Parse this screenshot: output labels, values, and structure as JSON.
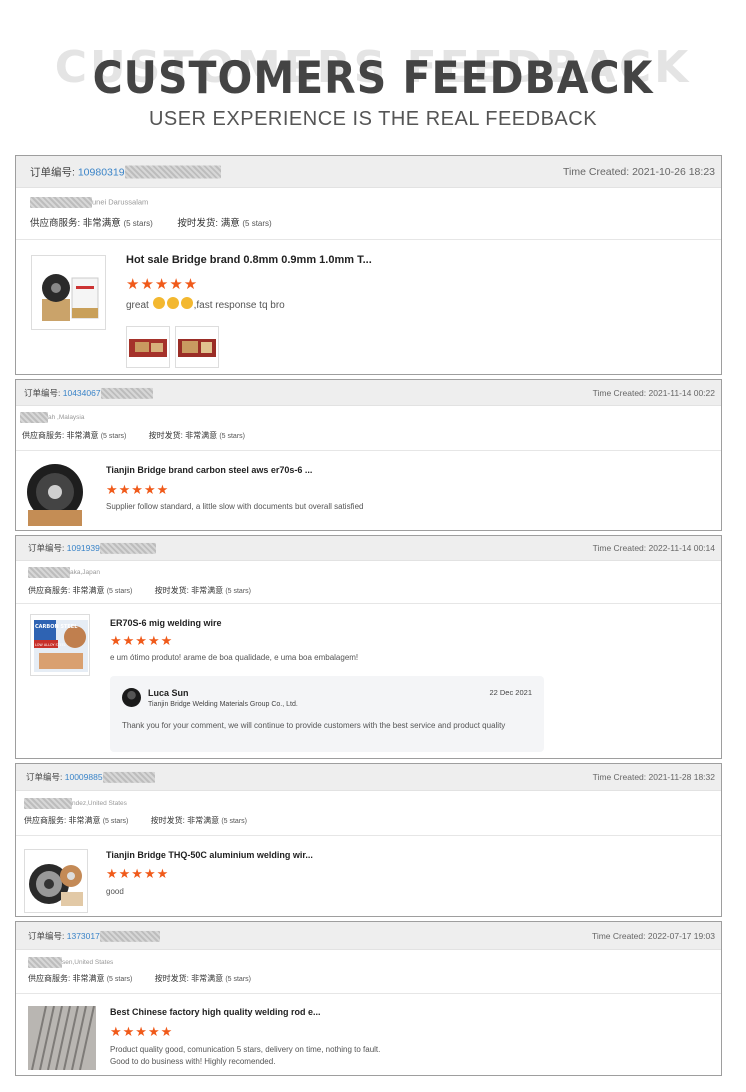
{
  "header": {
    "ghost_text": "CUSTOMERS FEEDBACK",
    "title": "CUSTOMERS FEEDBACK",
    "subtitle": "USER EXPERIENCE IS THE REAL FEEDBACK"
  },
  "common": {
    "order_label": "订单编号:",
    "service_label": "供应商服务:",
    "shipping_label": "按时发货:",
    "stars_text": "(5 stars)",
    "time_label": "Time Created:",
    "accent_color": "#f05a1a",
    "link_color": "#3a84c8"
  },
  "reviews": [
    {
      "order_no": "10980319",
      "time": "2021-10-26 18:23",
      "location": "unei Darussalam",
      "service_value": "非常满意",
      "shipping_value": "满意",
      "product": "Hot sale Bridge brand 0.8mm 0.9mm 1.0mm T...",
      "stars": "★★★★★",
      "comment_a": "great",
      "comment_b": ",fast response tq bro",
      "image_icon": "welding-wire-spool-box",
      "attachments": [
        "attachment-photo-1",
        "attachment-photo-2"
      ]
    },
    {
      "order_no": "10434067",
      "time": "2021-11-14 00:22",
      "location": "ah ,Malaysia",
      "service_value": "非常满意",
      "shipping_value": "非常满意",
      "product": "Tianjin Bridge brand carbon steel aws er70s-6 ...",
      "stars": "★★★★★",
      "comment": "Supplier follow standard, a little slow with documents but overall satisfied",
      "image_icon": "wire-spool-icon"
    },
    {
      "order_no": "1091939",
      "time": "2022-11-14 00:14",
      "location": "aka,Japan",
      "service_value": "非常满意",
      "shipping_value": "非常满意",
      "product": "ER70S-6 mig welding wire",
      "stars": "★★★★★",
      "comment": "e um ótimo produto! arame de boa qualidade, e uma boa embalagem!",
      "image_icon": "carbon-steel-box",
      "box_label_1": "CARBON STEEL",
      "box_label_2": "LOW ALLOY STEEL",
      "reply": {
        "name": "Luca Sun",
        "company": "Tianjin Bridge Welding Materials Group Co., Ltd.",
        "date": "22 Dec 2021",
        "text": "Thank you for your comment, we will continue to provide customers with the best service and product quality"
      }
    },
    {
      "order_no": "10009885",
      "time": "2021-11-28 18:32",
      "location": "ndez,United States",
      "service_value": "非常满意",
      "shipping_value": "非常满意",
      "product": "Tianjin Bridge THQ-50C aluminium welding wir...",
      "stars": "★★★★★",
      "comment": "good",
      "image_icon": "wire-spools-icon"
    },
    {
      "order_no": "1373017",
      "time": "2022-07-17 19:03",
      "location": "sen,United States",
      "service_value": "非常满意",
      "shipping_value": "非常满意",
      "product": "Best Chinese factory high quality welding rod e...",
      "stars": "★★★★★",
      "comment_line1": "Product quality good, comunication 5 stars, delivery on time, nothing to fault.",
      "comment_line2": "Good to do business with! Highly recomended.",
      "image_icon": "welding-rods-icon"
    }
  ]
}
